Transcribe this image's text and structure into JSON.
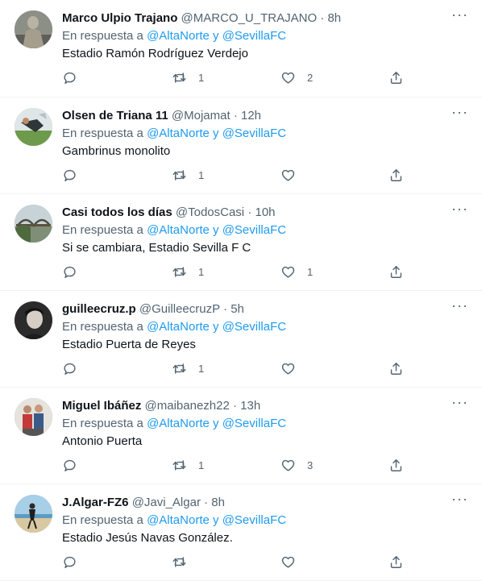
{
  "reply_prefix": "En respuesta a",
  "reply_and": "y",
  "more_glyph": "···",
  "colors": {
    "link": "#1d9bf0",
    "muted": "#536471",
    "text": "#0f1419",
    "divider": "#eff3f4"
  },
  "tweets": [
    {
      "name": "Marco Ulpio Trajano",
      "handle": "@MARCO_U_TRAJANO",
      "time": "8h",
      "reply_to": [
        "@AltaNorte",
        "@SevillaFC"
      ],
      "text": "Estadio Ramón Rodríguez Verdejo",
      "replies": "",
      "retweets": "1",
      "likes": "2",
      "avatar": "statue-avatar"
    },
    {
      "name": "Olsen de Triana 11",
      "handle": "@Mojamat",
      "time": "12h",
      "reply_to": [
        "@AltaNorte",
        "@SevillaFC"
      ],
      "text": "Gambrinus monolito",
      "replies": "",
      "retweets": "1",
      "likes": "",
      "avatar": "football-avatar"
    },
    {
      "name": "Casi todos los días",
      "handle": "@TodosCasi",
      "time": "10h",
      "reply_to": [
        "@AltaNorte",
        "@SevillaFC"
      ],
      "text": "Si se cambiara, Estadio Sevilla F C",
      "replies": "",
      "retweets": "1",
      "likes": "1",
      "avatar": "bridge-avatar"
    },
    {
      "name": "guilleecruz.p",
      "handle": "@GuilleecruzP",
      "time": "5h",
      "reply_to": [
        "@AltaNorte",
        "@SevillaFC"
      ],
      "text": "Estadio Puerta de Reyes",
      "replies": "",
      "retweets": "1",
      "likes": "",
      "avatar": "portrait-avatar"
    },
    {
      "name": "Miguel Ibáñez",
      "handle": "@maibanezh22",
      "time": "13h",
      "reply_to": [
        "@AltaNorte",
        "@SevillaFC"
      ],
      "text": "Antonio Puerta",
      "replies": "",
      "retweets": "1",
      "likes": "3",
      "avatar": "group-avatar"
    },
    {
      "name": "J.Algar-FZ6",
      "handle": "@Javi_Algar",
      "time": "8h",
      "reply_to": [
        "@AltaNorte",
        "@SevillaFC"
      ],
      "text": "Estadio Jesús Navas González.",
      "replies": "",
      "retweets": "",
      "likes": "",
      "avatar": "beach-avatar"
    }
  ]
}
